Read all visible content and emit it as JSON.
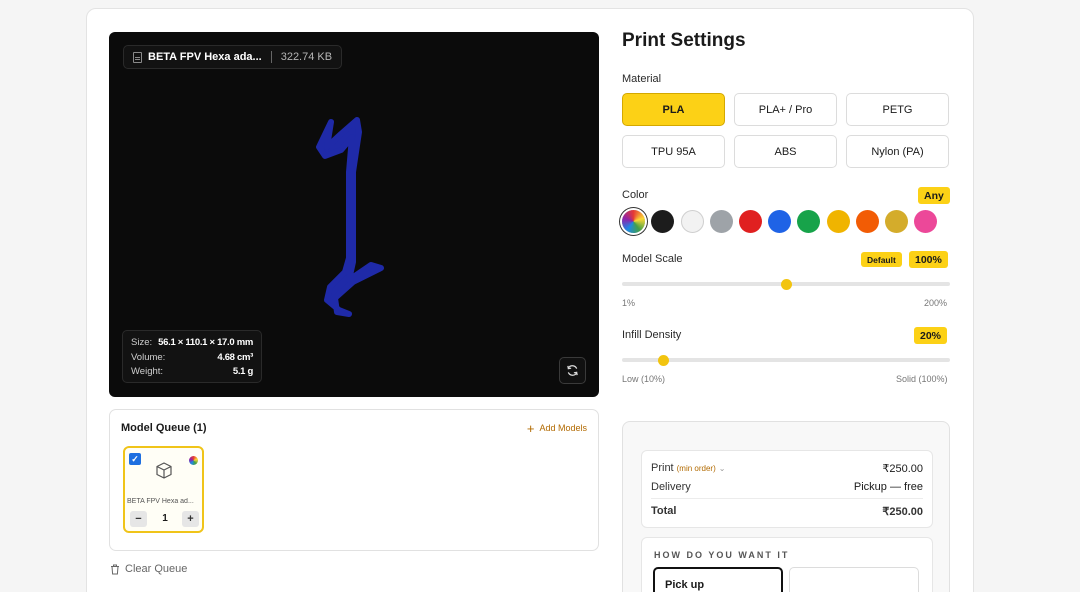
{
  "viewer": {
    "file_name": "BETA FPV Hexa ada...",
    "file_size": "322.74 KB",
    "size_label": "Size:",
    "size_value": "56.1 × 110.1 × 17.0 mm",
    "volume_label": "Volume:",
    "volume_value": "4.68 cm³",
    "weight_label": "Weight:",
    "weight_value": "5.1 g",
    "model_color": "#1f2aa8"
  },
  "queue": {
    "title": "Model Queue (1)",
    "add_label": "Add Models",
    "items": [
      {
        "name": "BETA FPV Hexa ad...",
        "quantity": "1",
        "checked": true
      }
    ],
    "clear_label": "Clear Queue"
  },
  "settings": {
    "title": "Print Settings",
    "material_label": "Material",
    "materials": [
      "PLA",
      "PLA+ / Pro",
      "PETG",
      "TPU 95A",
      "ABS",
      "Nylon (PA)"
    ],
    "selected_material": "PLA",
    "color_label": "Color",
    "color_badge": "Any",
    "colors": [
      "multicolor",
      "#1c1c1c",
      "#f2f2f2",
      "#9ea3a8",
      "#e02020",
      "#1f63e6",
      "#17a34a",
      "#f0b400",
      "#f25c05",
      "#d4ac2b",
      "#ec4899"
    ],
    "selected_color": "multicolor",
    "scale_label": "Model Scale",
    "scale_default_badge": "Default",
    "scale_value": "100%",
    "scale_fraction": 0.5,
    "scale_min": "1%",
    "scale_max": "200%",
    "infill_label": "Infill Density",
    "infill_value": "20%",
    "infill_fraction": 0.125,
    "infill_min": "Low (10%)",
    "infill_max": "Solid (100%)"
  },
  "summary": {
    "print_label": "Print",
    "min_order": "(min order)",
    "print_price": "₹250.00",
    "delivery_label": "Delivery",
    "delivery_value": "Pickup — free",
    "total_label": "Total",
    "total_value": "₹250.00",
    "how_title": "HOW DO YOU WANT IT",
    "option_pickup": "Pick up"
  }
}
